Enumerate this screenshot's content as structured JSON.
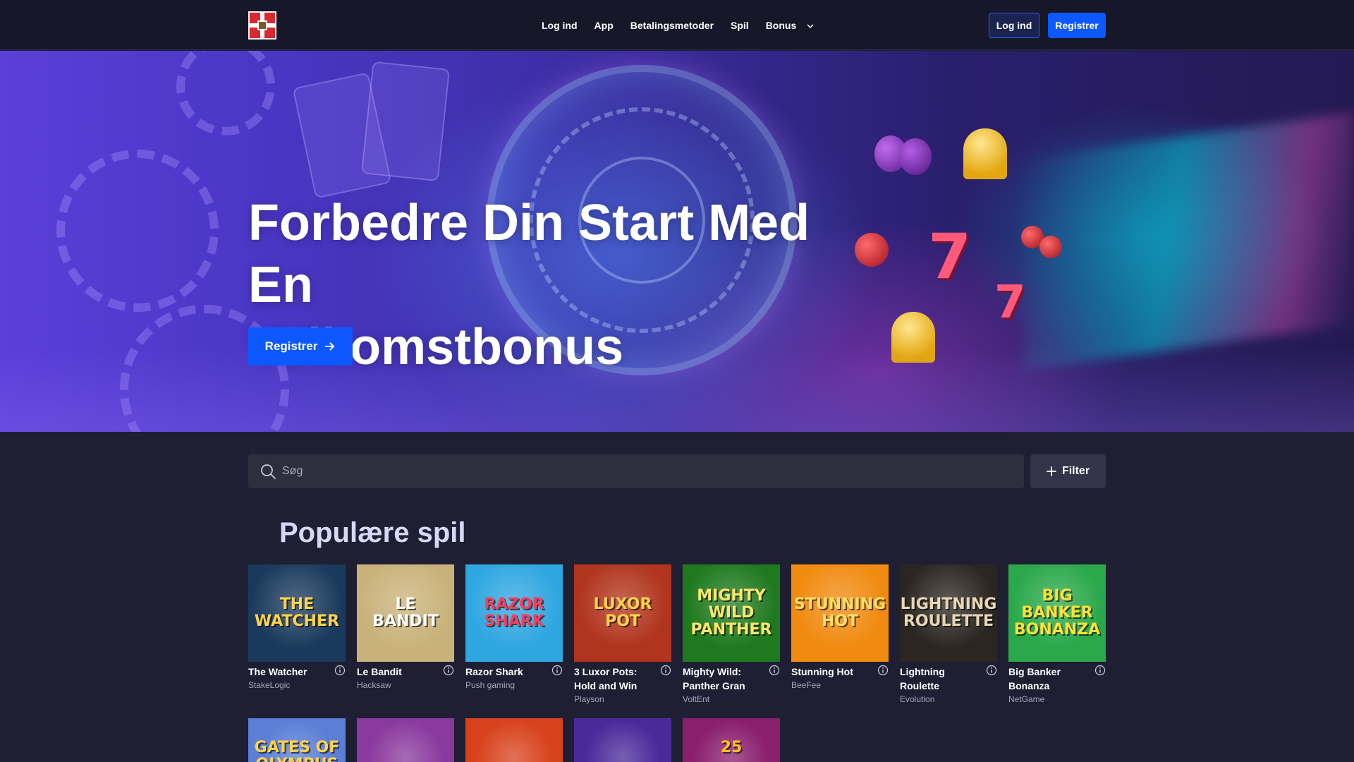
{
  "header": {
    "logo_alt": "",
    "nav": [
      {
        "label": "Log ind"
      },
      {
        "label": "App"
      },
      {
        "label": "Betalingsmetoder"
      },
      {
        "label": "Spil"
      },
      {
        "label": "Bonus",
        "dropdown": true
      }
    ],
    "login_label": "Log ind",
    "register_label": "Registrer"
  },
  "hero": {
    "title_line1": "Forbedre Din Start Med En",
    "title_line2": "Velkomstbonus",
    "cta_label": "Registrer",
    "cta_icon": "arrow-right-icon"
  },
  "search": {
    "placeholder": "Søg",
    "value": "",
    "icon": "search-icon",
    "filter_label": "Filter",
    "filter_icon": "plus-icon"
  },
  "popular": {
    "title": "Populære spil",
    "games": [
      {
        "name": "The Watcher",
        "provider": "StakeLogic",
        "art": "THE WATCHER",
        "bg": "#1a3a5c",
        "fg": "#ffd34a"
      },
      {
        "name": "Le Bandit",
        "provider": "Hacksaw",
        "art": "LE BANDIT",
        "bg": "#c9b27a",
        "fg": "#ffffff"
      },
      {
        "name": "Razor Shark",
        "provider": "Push gaming",
        "art": "RAZOR SHARK",
        "bg": "#2ea6e0",
        "fg": "#ff3d5a"
      },
      {
        "name": "3 Luxor Pots: Hold and Win",
        "provider": "Playson",
        "art": "LUXOR POT",
        "bg": "#b1341c",
        "fg": "#ffd34a"
      },
      {
        "name": "Mighty Wild: Panther Gran",
        "provider": "VoltEnt",
        "art": "MIGHTY WILD PANTHER",
        "bg": "#1f7a1f",
        "fg": "#ffe66a"
      },
      {
        "name": "Stunning Hot",
        "provider": "BeeFee",
        "art": "STUNNING HOT",
        "bg": "#f08a10",
        "fg": "#ffe066"
      },
      {
        "name": "Lightning Roulette",
        "provider": "Evolution",
        "art": "LIGHTNING ROULETTE",
        "bg": "#2b2622",
        "fg": "#e7d7b3"
      },
      {
        "name": "Big Banker Bonanza",
        "provider": "NetGame",
        "art": "BIG BANKER BONANZA",
        "bg": "#2aa84a",
        "fg": "#ffe03a"
      }
    ],
    "row2": [
      {
        "art": "GATES OF OLYMPUS",
        "bg": "#5b7fd6",
        "fg": "#ffd34a"
      },
      {
        "art": "",
        "bg": "#8a3a9e",
        "fg": "#ffffff"
      },
      {
        "art": "",
        "bg": "#d8431e",
        "fg": "#ffd34a"
      },
      {
        "art": "",
        "bg": "#4a2a9a",
        "fg": "#ffffff"
      },
      {
        "art": "25",
        "bg": "#8a1f6e",
        "fg": "#ffc21a"
      }
    ]
  },
  "colors": {
    "accent": "#0d58ff",
    "bg": "#1f1f33",
    "header_bg": "#17172a",
    "section_title": "#d6d8f5"
  }
}
